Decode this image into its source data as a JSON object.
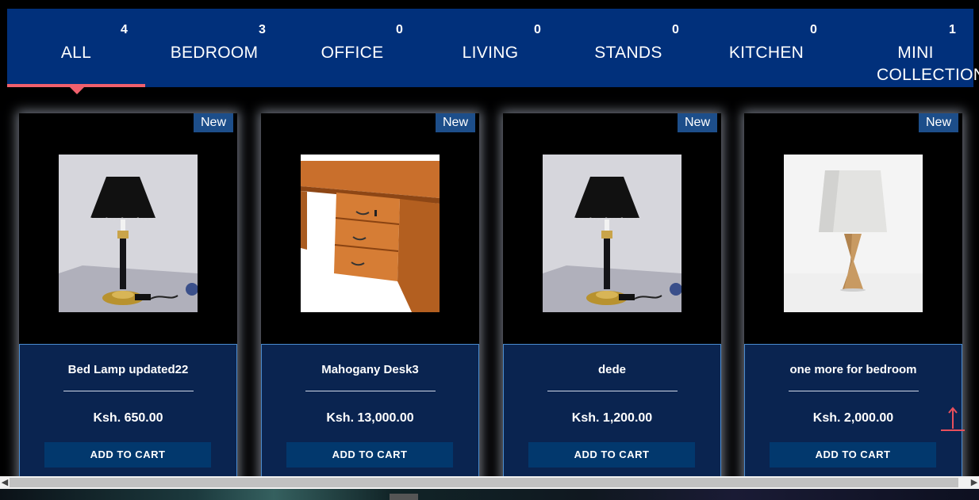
{
  "tabs": [
    {
      "label": "ALL",
      "count": "4"
    },
    {
      "label": "BEDROOM",
      "count": "3"
    },
    {
      "label": "OFFICE",
      "count": "0"
    },
    {
      "label": "LIVING",
      "count": "0"
    },
    {
      "label": "STANDS",
      "count": "0"
    },
    {
      "label": "KITCHEN",
      "count": "0"
    },
    {
      "label": "MINI COLLECTION",
      "count": "1"
    }
  ],
  "active_tab": "ALL",
  "products": [
    {
      "badge": "New",
      "name": "Bed Lamp updated22",
      "price": "Ksh. 650.00",
      "button": "ADD TO CART",
      "image_icon": "black-table-lamp-photo"
    },
    {
      "badge": "New",
      "name": "Mahogany Desk3",
      "price": "Ksh. 13,000.00",
      "button": "ADD TO CART",
      "image_icon": "wooden-desk-photo"
    },
    {
      "badge": "New",
      "name": "dede",
      "price": "Ksh. 1,200.00",
      "button": "ADD TO CART",
      "image_icon": "black-table-lamp-photo"
    },
    {
      "badge": "New",
      "name": "one more for bedroom",
      "price": "Ksh. 2,000.00",
      "button": "ADD TO CART",
      "image_icon": "white-shade-lamp-photo"
    }
  ],
  "colors": {
    "tab_bar": "#01307b",
    "active_underline": "#f0606d",
    "card_info": "#0a2450",
    "button": "#02386d",
    "badge": "#1d4e8a"
  },
  "scroll_to_top_icon": "arrow-up-icon"
}
